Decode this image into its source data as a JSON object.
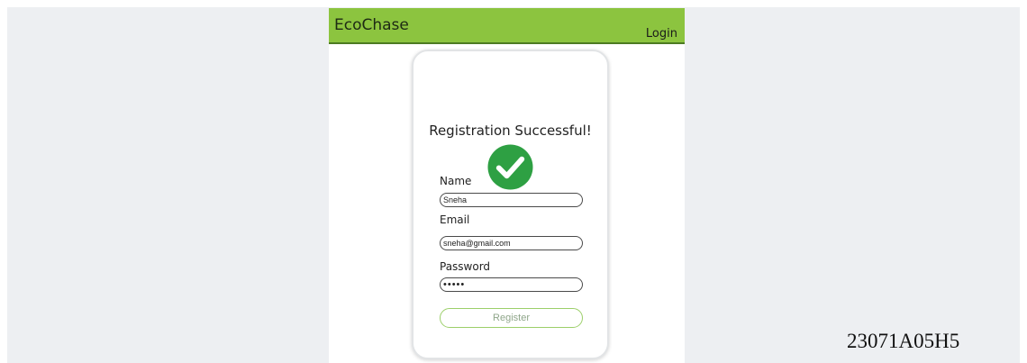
{
  "app": {
    "title": "EcoChase",
    "login_label": "Login"
  },
  "card": {
    "heading": "Registration Successful!",
    "success_icon": "check-circle-icon",
    "success_color": "#2ea043"
  },
  "form": {
    "name_label": "Name",
    "name_value": "Sneha",
    "email_label": "Email",
    "email_value": "sneha@gmail.com",
    "password_label": "Password",
    "password_value": "•••••",
    "register_label": "Register"
  },
  "colors": {
    "appbar": "#8cc43f",
    "backdrop": "#edeff2",
    "register_border": "#9ccf6a"
  },
  "overlay": {
    "id_text": "23071A05H5"
  }
}
